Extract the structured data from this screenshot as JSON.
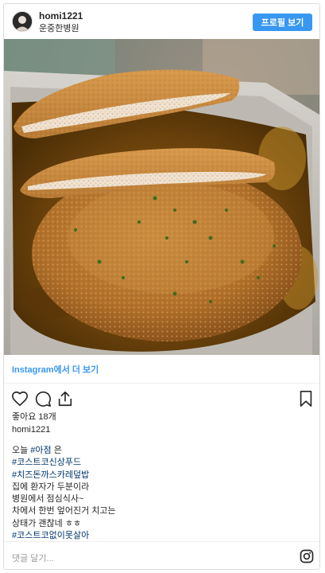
{
  "header": {
    "username": "homi1221",
    "location": "운중한병원",
    "profile_button": "프로필 보기"
  },
  "photo": {
    "description": "cheese pork cutlet curry in a foil tray"
  },
  "more_link": "Instagram에서 더 보기",
  "actions": {
    "icons": [
      "heart-icon",
      "comment-icon",
      "share-icon",
      "bookmark-icon"
    ]
  },
  "likes": "좋아요 18개",
  "author": "homi1221",
  "caption": {
    "lines": [
      {
        "pre": "오늘 ",
        "tag": "#아점",
        "post": " 은"
      },
      {
        "pre": "",
        "tag": "#코스트코신상푸드",
        "post": ""
      },
      {
        "pre": "",
        "tag": "#치즈돈까스카레덮밥",
        "post": ""
      },
      {
        "pre": "집에 환자가 두분이라",
        "tag": "",
        "post": ""
      },
      {
        "pre": "병원에서 점심식사~",
        "tag": "",
        "post": ""
      },
      {
        "pre": "차에서 한번 엎어진거 치고는",
        "tag": "",
        "post": ""
      },
      {
        "pre": "상태가 괜찮네 ㅎㅎ",
        "tag": "",
        "post": ""
      },
      {
        "pre": "",
        "tag": "#코스트코없이못살아",
        "post": ""
      }
    ]
  },
  "comment": {
    "placeholder": "댓글 달기..."
  },
  "colors": {
    "accent": "#3897f0",
    "hashtag": "#003569",
    "text": "#262626"
  }
}
